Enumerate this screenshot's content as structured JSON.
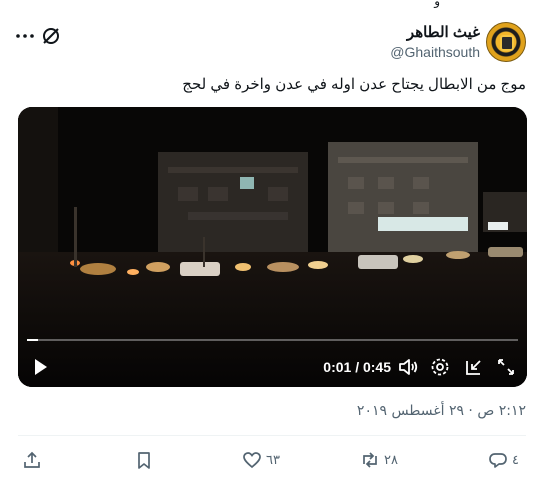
{
  "header": {
    "display_name": "غيث الطاهر",
    "handle": "@Ghaithsouth",
    "top_fragment": "و"
  },
  "tweet": {
    "text": "موج من الابطال يجتاح عدن اوله في عدن واخرة في لحج"
  },
  "video": {
    "time_display": "0:01 / 0:45",
    "progress_fraction": 0.022
  },
  "meta": {
    "timestamp": "٢:١٢ ص · ٢٩ أغسطس ٢٠١٩"
  },
  "actions": {
    "like_count": "٦٣",
    "retweet_count": "٢٨",
    "reply_count": "٤"
  },
  "icons": {
    "more": "more-icon",
    "grok": "grok-icon",
    "play": "play-icon",
    "volume": "volume-icon",
    "settings": "settings-icon",
    "pip": "pip-icon",
    "fullscreen": "fullscreen-icon",
    "share": "share-icon",
    "bookmark": "bookmark-icon",
    "like": "heart-icon",
    "retweet": "retweet-icon",
    "reply": "reply-icon"
  },
  "colors": {
    "text_primary": "#0f1419",
    "text_secondary": "#536471",
    "divider": "#eff3f4",
    "video_bg": "#0a0908"
  }
}
